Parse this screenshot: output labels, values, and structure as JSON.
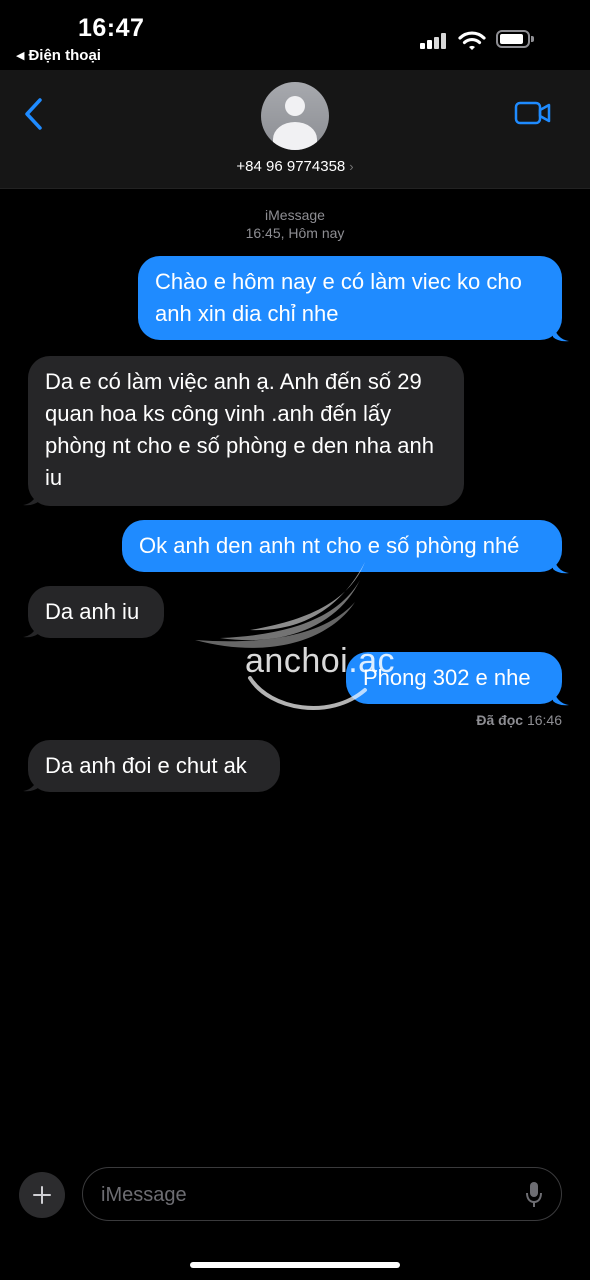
{
  "status": {
    "time": "16:47",
    "back_app": "Điện thoại",
    "icons": [
      "signal-icon",
      "wifi-icon",
      "battery-icon"
    ]
  },
  "header": {
    "contact": "+84 96 9774358",
    "icons": [
      "back-chevron-icon",
      "avatar-icon",
      "video-call-icon"
    ],
    "accent_color": "#1f8bff"
  },
  "thread": {
    "service": "iMessage",
    "timestamp": "16:45, Hôm nay",
    "messages": [
      {
        "dir": "out",
        "text": "Chào e hôm nay e có làm viec ko cho anh xin dia chỉ nhe"
      },
      {
        "dir": "in",
        "text": "Da e có làm việc anh ạ. Anh đến số 29 quan hoa ks công vinh .anh đến lấy phòng nt cho e số phòng e den nha anh iu"
      },
      {
        "dir": "out",
        "text": "Ok anh den anh nt cho e số phòng nhé"
      },
      {
        "dir": "in",
        "text": "Da anh iu"
      },
      {
        "dir": "out",
        "text": "Phong 302 e nhe"
      },
      {
        "dir": "in",
        "text": "Da anh đoi e chut ak"
      }
    ],
    "read_label": "Đã đọc",
    "read_time": "16:46",
    "outgoing_color": "#1f8bff",
    "incoming_color": "#262628"
  },
  "watermark": "anchoi.ac",
  "composer": {
    "placeholder": "iMessage",
    "icons": [
      "plus-icon",
      "microphone-icon"
    ]
  }
}
